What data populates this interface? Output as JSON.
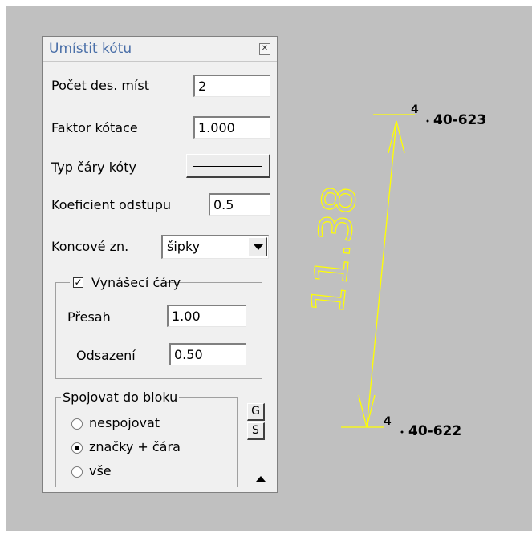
{
  "palette": {
    "title": "Umístit kótu",
    "close_icon": "close-icon",
    "fields": {
      "decimals": {
        "label": "Počet des. míst",
        "value": "2"
      },
      "scale": {
        "label": "Faktor kótace",
        "value": "1.000"
      },
      "line_type": {
        "label": "Typ čáry kóty"
      },
      "offset_coef": {
        "label": "Koeficient odstupu",
        "value": "0.5"
      },
      "end_marks": {
        "label": "Koncové zn.",
        "value": "šipky"
      }
    },
    "extension_lines": {
      "label": "Vynášecí čáry",
      "checked": true,
      "overshoot": {
        "label": "Přesah",
        "value": "1.00"
      },
      "offset": {
        "label": "Odsazení",
        "value": "0.50"
      }
    },
    "block_group": {
      "title": "Spojovat do bloku",
      "options": [
        {
          "label": "nespojovat",
          "selected": false
        },
        {
          "label": "značky + čára",
          "selected": true
        },
        {
          "label": "vše",
          "selected": false
        }
      ],
      "btn_g": "G",
      "btn_s": "S"
    }
  },
  "drawing": {
    "dimension_text": "11.38",
    "points": [
      {
        "number": "4",
        "label": "40-623"
      },
      {
        "number": "4",
        "label": "40-622"
      }
    ],
    "line_color": "#ffff00"
  },
  "colors": {
    "canvas": "#c0c0c0",
    "title": "#4a6fa8"
  }
}
